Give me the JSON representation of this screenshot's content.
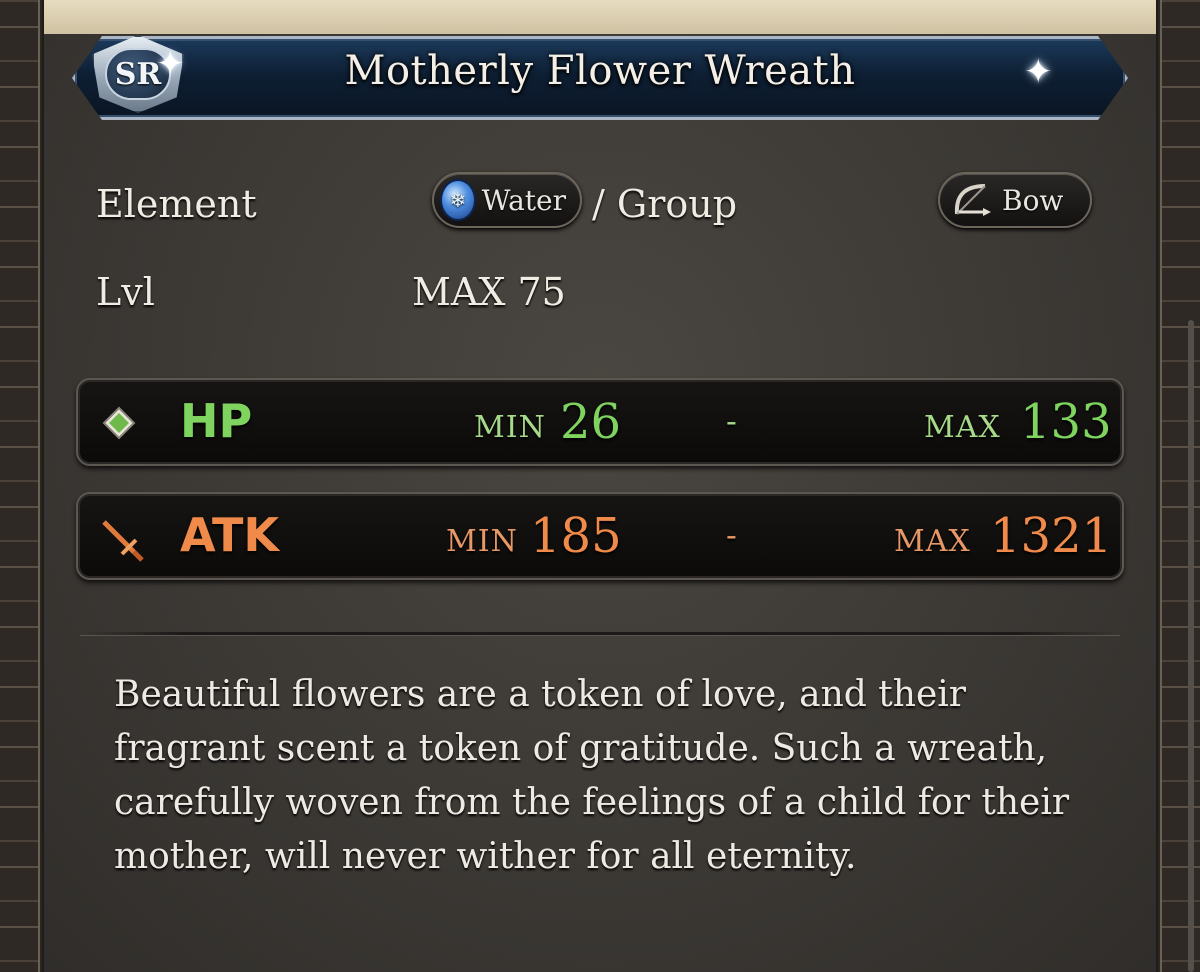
{
  "item": {
    "rarity": "SR",
    "name": "Motherly Flower Wreath"
  },
  "info": {
    "element_label": "Element",
    "element_value": "Water",
    "group_text": "/ Group",
    "weapon_type": "Bow",
    "level_label": "Lvl",
    "level_value": "MAX 75"
  },
  "stats": {
    "hp": {
      "label": "HP",
      "min_label": "MIN",
      "min": "26",
      "dash": "-",
      "max_label": "MAX",
      "max": "133"
    },
    "atk": {
      "label": "ATK",
      "min_label": "MIN",
      "min": "185",
      "dash": "-",
      "max_label": "MAX",
      "max": "1321"
    }
  },
  "description": "Beautiful flowers are a token of love, and their fragrant scent a token of gratitude. Such a wreath, carefully woven from the feelings of a child for their mother, will never wither for all eternity.",
  "colors": {
    "hp": "#7fd35f",
    "atk": "#f08a4a",
    "title_bar": "#0e1f33",
    "panel": "#3c3935"
  },
  "icons": {
    "element": "water-orb-icon",
    "weapon": "bow-icon",
    "hp": "diamond-icon",
    "atk": "sword-icon",
    "rarity": "sr-badge-icon"
  }
}
